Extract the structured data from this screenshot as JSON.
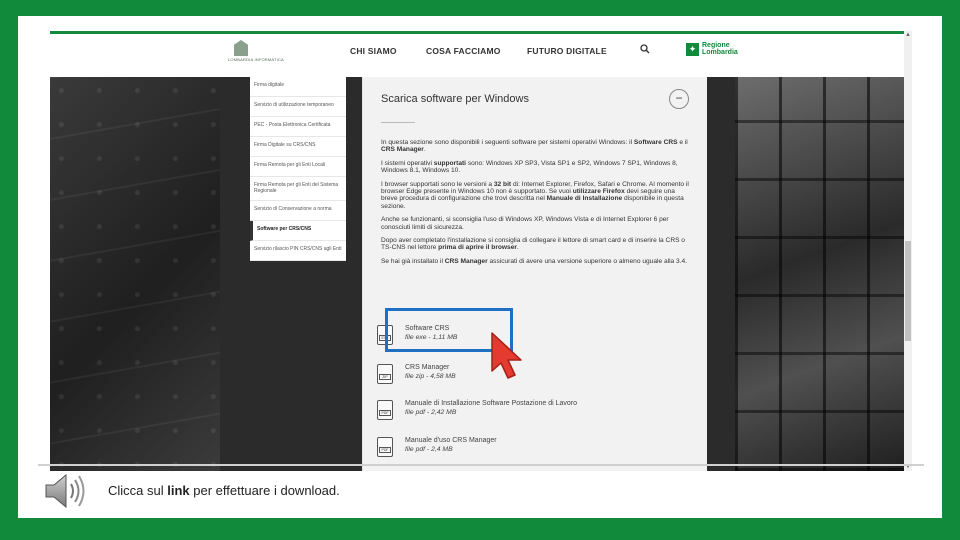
{
  "nav": {
    "logo_text": "LOMBARDIA INFORMATICA",
    "items": [
      "CHI SIAMO",
      "COSA FACCIAMO",
      "FUTURO DIGITALE"
    ],
    "search_icon": "search-icon",
    "region_line1": "Regione",
    "region_line2": "Lombardia"
  },
  "sidebar": {
    "items": [
      {
        "label": "Firma digitale"
      },
      {
        "label": "Servizio di utilizzazione temporaneo"
      },
      {
        "label": "PEC - Posta Elettronica Certificata"
      },
      {
        "label": "Firma Digitale su CRS/CNS"
      },
      {
        "label": "Firma Remota per gli Enti Locali"
      },
      {
        "label": "Firma Remota per gli Enti del Sistema Regionale"
      },
      {
        "label": "Servizio di Conservazione a norma"
      },
      {
        "label": "Software per CRS/CNS",
        "active": true
      },
      {
        "label": "Servizio rilascio PIN CRS/CNS agli Enti"
      }
    ]
  },
  "content": {
    "title": "Scarica software per Windows",
    "collapse_symbol": "−",
    "p1a": "In questa sezione sono disponibili i seguenti software per sistemi operativi Windows: il ",
    "p1b": "Software CRS",
    "p1c": " e il ",
    "p1d": "CRS Manager",
    "p1e": ".",
    "p2a": "I sistemi operativi ",
    "p2b": "supportati",
    "p2c": " sono: Windows XP SP3, Vista SP1 e SP2, Windows 7 SP1, Windows 8, Windows 8.1, Windows 10.",
    "p3a": "I browser supportati sono le versioni a ",
    "p3b": "32 bit",
    "p3c": " di: Internet Explorer, Firefox, Safari e Chrome. Al momento il browser Edge presente in Windows 10 non è supportato. Se vuoi ",
    "p3d": "utilizzare Firefox",
    "p3e": " devi seguire una breve procedura di configurazione che trovi descritta nel ",
    "p3f": "Manuale di Installazione",
    "p3g": " disponibile in questa sezione.",
    "p4": "Anche se funzionanti, si sconsiglia l'uso di Windows XP, Windows Vista e di Internet Explorer 6 per conosciuti limiti di sicurezza.",
    "p5a": "Dopo aver completato l'installazione si consiglia di collegare il lettore di smart card e di inserire la CRS o TS-CNS nel lettore ",
    "p5b": "prima di aprire il browser",
    "p5c": ".",
    "p6a": "Se hai già installato il ",
    "p6b": "CRS Manager",
    "p6c": " assicurati di avere una versione superiore o almeno uguale alla 3.4.",
    "downloads": [
      {
        "name": "Software CRS",
        "meta": "file exe - 1,11 MB",
        "ext": "EXE"
      },
      {
        "name": "CRS Manager",
        "meta": "file zip - 4,58 MB",
        "ext": "ZIP"
      },
      {
        "name": "Manuale di Installazione Software Postazione di Lavoro",
        "meta": "file pdf - 2,42 MB",
        "ext": "PDF"
      },
      {
        "name": "Manuale d'uso CRS Manager",
        "meta": "file pdf - 2,4 MB",
        "ext": "PDF"
      }
    ]
  },
  "caption": {
    "a": "Clicca sul ",
    "b": "link",
    "c": " per effettuare i download."
  },
  "colors": {
    "frame": "#118a3b",
    "highlight": "#1f6fc5",
    "cursor": "#e53a2f"
  }
}
